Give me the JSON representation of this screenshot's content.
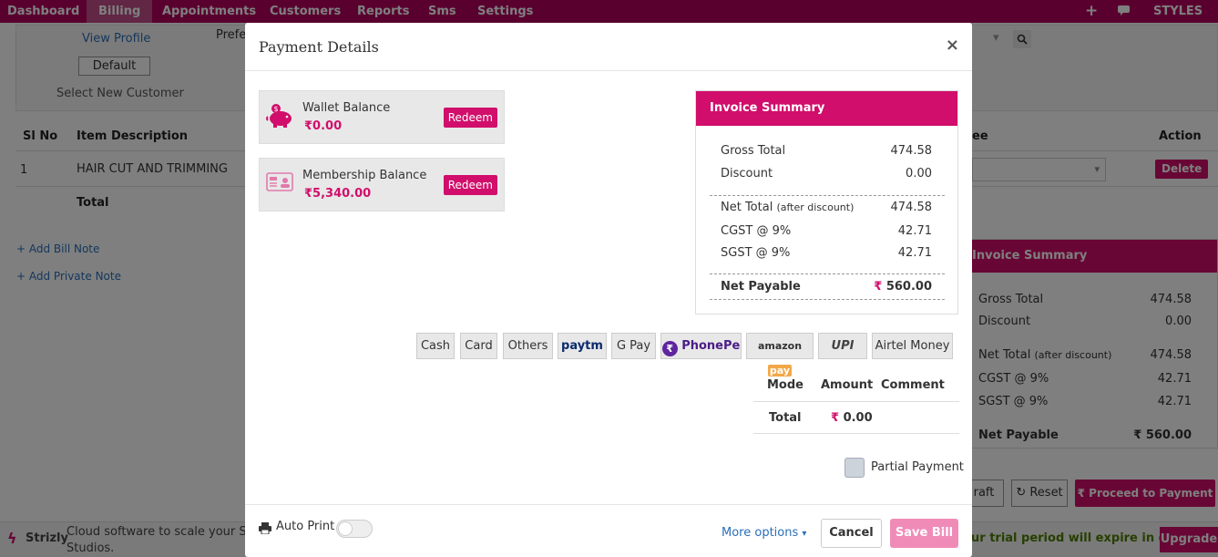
{
  "nav": {
    "items": [
      "Dashboard",
      "Billing",
      "Appointments",
      "Customers",
      "Reports",
      "Sms",
      "Settings"
    ],
    "brand": "STYLES"
  },
  "background": {
    "view_profile": "View Profile",
    "prefix_text": "Prefe",
    "default_button": "Default",
    "select_customer": "Select New Customer",
    "table": {
      "headers": [
        "Sl No",
        "Item Description",
        "ee",
        "Action"
      ],
      "row": {
        "sl": "1",
        "desc": "HAIR CUT AND TRIMMING"
      },
      "total_label": "Total",
      "delete": "Delete"
    },
    "add_bill_note": "+ Add Bill Note",
    "add_private_note": "+ Add Private Note",
    "summary": {
      "title": "Invoice Summary",
      "gross_label": "Gross Total",
      "gross": "474.58",
      "discount_label": "Discount",
      "discount": "0.00",
      "net_label": "Net Total",
      "net_note": "(after discount)",
      "net": "474.58",
      "cgst_label": "CGST @ 9%",
      "cgst": "42.71",
      "sgst_label": "SGST @ 9%",
      "sgst": "42.71",
      "payable_label": "Net Payable",
      "payable": "560.00"
    },
    "draft": "raft",
    "reset": "Reset",
    "proceed": "Proceed to Payment",
    "footer_brand": "Strizly",
    "footer_text_1": "Cloud software to scale your Salo",
    "footer_text_2": "Studios.",
    "trial": "ur trial period will expire in days",
    "upgrade": "Upgrade"
  },
  "modal": {
    "title": "Payment Details",
    "close": "×",
    "wallet": {
      "label": "Wallet Balance",
      "amount": "0.00",
      "redeem": "Redeem"
    },
    "membership": {
      "label": "Membership Balance",
      "amount": "5,340.00",
      "redeem": "Redeem"
    },
    "summary": {
      "title": "Invoice Summary",
      "gross_label": "Gross Total",
      "gross": "474.58",
      "discount_label": "Discount",
      "discount": "0.00",
      "net_label": "Net Total",
      "net_note": "(after discount)",
      "net": "474.58",
      "cgst_label": "CGST @ 9%",
      "cgst": "42.71",
      "sgst_label": "SGST @ 9%",
      "sgst": "42.71",
      "payable_label": "Net Payable",
      "payable": "560.00"
    },
    "pay_modes": {
      "cash": "Cash",
      "card": "Card",
      "others": "Others",
      "paytm": "paytm",
      "gpay": "G Pay",
      "phonepe": "PhonePe",
      "amazon": "amazon",
      "amazon_pay": "pay",
      "upi": "UPI",
      "airtel": "Airtel Money"
    },
    "table": {
      "mode": "Mode",
      "amount": "Amount",
      "comment": "Comment",
      "total_label": "Total",
      "total": "0.00"
    },
    "partial_payment": "Partial Payment",
    "auto_print": "Auto Print",
    "more_options": "More options",
    "cancel": "Cancel",
    "save_bill": "Save Bill"
  },
  "colors": {
    "brand": "#b3005e",
    "accent": "#d10e6b"
  }
}
